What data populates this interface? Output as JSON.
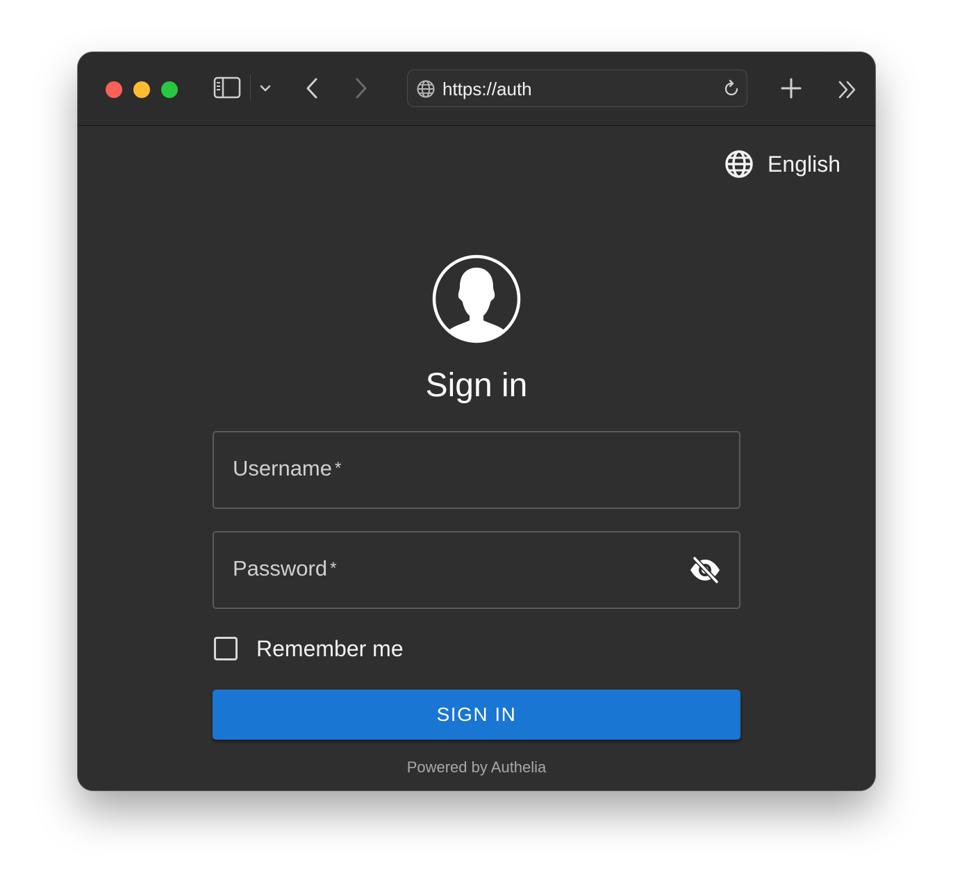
{
  "browser": {
    "url": "https://auth",
    "traffic_light_colors": {
      "close": "#fe5f57",
      "minimize": "#febc2e",
      "zoom": "#28c840"
    },
    "icons": [
      "sidebar-icon",
      "chevron-down-icon",
      "back-icon",
      "forward-icon",
      "globe-icon",
      "reload-icon",
      "plus-icon",
      "overflow-icon"
    ]
  },
  "page": {
    "language": "English",
    "title": "Sign in",
    "username_label": "Username",
    "password_label": "Password",
    "required_marker": "*",
    "remember_label": "Remember me",
    "signin_label": "SIGN IN",
    "powered_by": "Powered by Authelia",
    "accent_color": "#1976d2",
    "background_color": "#2f2f2f"
  }
}
